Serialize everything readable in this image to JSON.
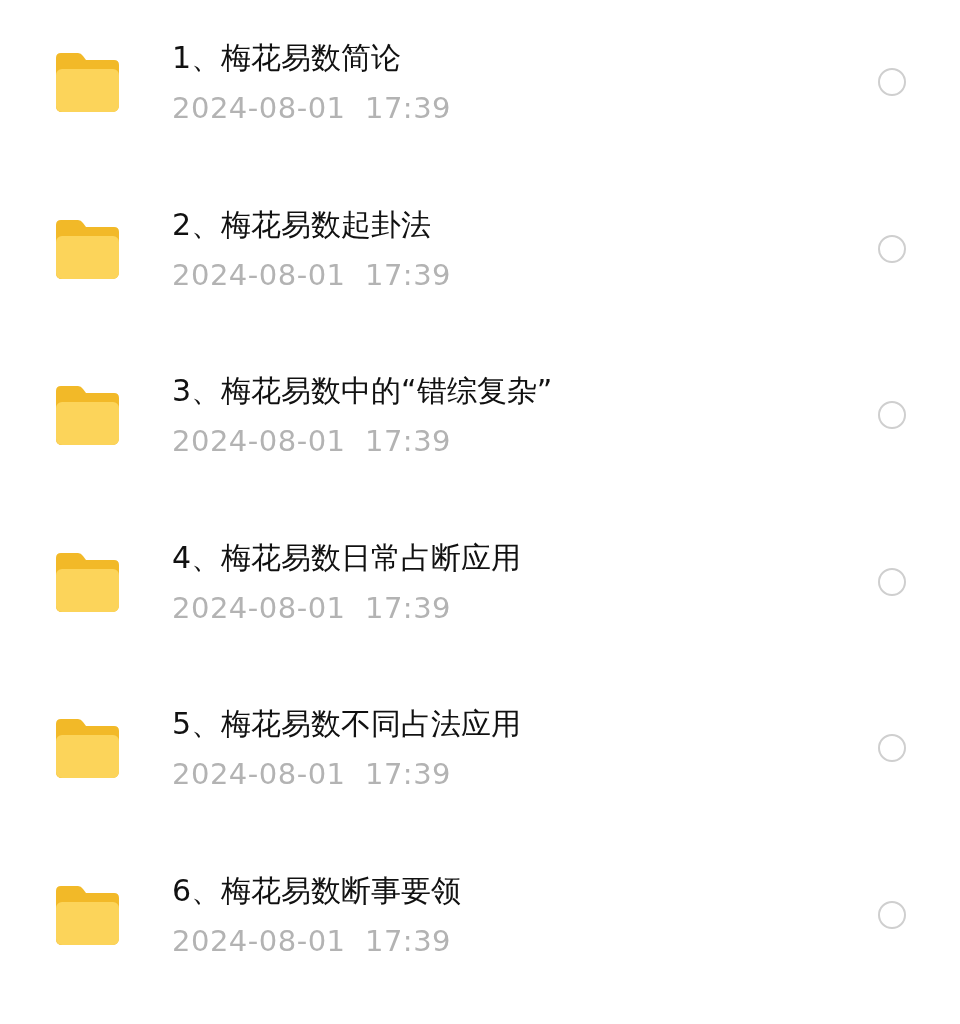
{
  "files": [
    {
      "name": "1、梅花易数简论",
      "modified": "2024-08-01  17:39",
      "selected": false
    },
    {
      "name": "2、梅花易数起卦法",
      "modified": "2024-08-01  17:39",
      "selected": false
    },
    {
      "name": "3、梅花易数中的“错综复杂”",
      "modified": "2024-08-01  17:39",
      "selected": false
    },
    {
      "name": "4、梅花易数日常占断应用",
      "modified": "2024-08-01  17:39",
      "selected": false
    },
    {
      "name": "5、梅花易数不同占法应用",
      "modified": "2024-08-01  17:39",
      "selected": false
    },
    {
      "name": "6、梅花易数断事要领",
      "modified": "2024-08-01  17:39",
      "selected": false
    }
  ]
}
